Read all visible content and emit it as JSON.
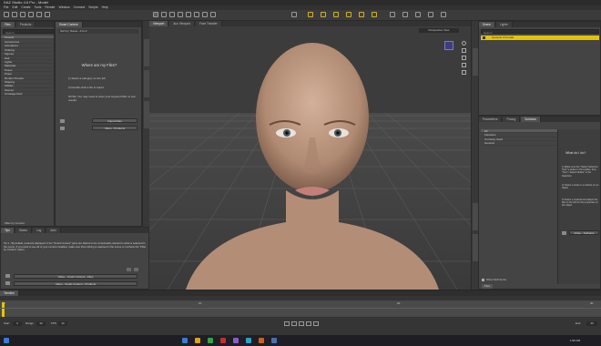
{
  "window": {
    "title": "DAZ Studio 4.6 Pro - Model"
  },
  "menu": [
    "File",
    "Edit",
    "Create",
    "Tools",
    "Render",
    "Window",
    "Connect",
    "Scripts",
    "Help"
  ],
  "left_panel": {
    "tabs": [
      "Files",
      "Products"
    ],
    "search_placeholder": "Search",
    "category_header": "Presets",
    "categories": [
      "Accessories",
      "Animations",
      "Clothing",
      "Figures",
      "Hair",
      "Lights",
      "Materials",
      "Poses",
      "Props",
      "Render Presets",
      "Shaping",
      "Utilities",
      "Scenes",
      "Uncategorized"
    ],
    "filter_label": "Filter by Context"
  },
  "content_panel": {
    "title_tab": "Smart Content",
    "subheader": "Sort by: Name - A to Z",
    "heading": "Where are my Files?",
    "steps": [
      "1) Select a category on the left",
      "2) Double-click a file to load it"
    ],
    "note": "NOTE: You may need to clear your keyword filter to see results.",
    "buttons": [
      "Import Files",
      "Video - Products"
    ]
  },
  "tips_panel": {
    "tabs": [
      "Tips",
      "Status",
      "Log",
      "Auto"
    ],
    "text": "Tip 1 - By default, products displayed in the \"Smart Content\" pane are filtered to be contextually relevant to what is selected in the scene. If you want to see all of your content installed, make sure that nothing is selected in the scene or uncheck the \"Filter by Context\" option.",
    "buttons": [
      "Video - Smart Content - Files",
      "Video - Smart Content - Products"
    ]
  },
  "viewport": {
    "tabs": [
      "Viewport",
      "Aux Viewport",
      "Face Transfer"
    ],
    "camera_label": "Perspective View"
  },
  "scene_panel": {
    "tabs": [
      "Scene",
      "Lights"
    ],
    "search_placeholder": "Search",
    "rows": [
      {
        "label": "Genesis 2 Female",
        "selected": true
      }
    ]
  },
  "parameters_panel": {
    "tabs": [
      "Parameters",
      "Posing",
      "Surfaces"
    ],
    "rows": [
      "All",
      "Favorites",
      "Currently Used",
      "General"
    ],
    "help_title": "What do I do?",
    "help_steps": [
      "1) Make sure the \"Select Selection Tool\" is active in the toolbar, then \"Tool > Select Nodes\" in the Selection",
      "2) Select a node or a surface on an object",
      "3) Select a material and adjust the lists to the left for the properties on the object"
    ],
    "button": "Video - Surfaces",
    "show_sub_items": "Show Sub Items"
  },
  "timeline": {
    "tab": "Timeline",
    "start_label": "Start",
    "start_value": "0",
    "range_label": "Range",
    "range_value": "30",
    "fps_label": "FPS",
    "fps_value": "30",
    "ticks": [
      "0",
      "10",
      "20",
      "30"
    ],
    "end_label": "End",
    "end_value": "30"
  },
  "taskbar": {
    "time": "1:55 PM",
    "icon_colors": [
      "#3a7bd5",
      "#e0a020",
      "#3aa04a",
      "#c03030",
      "#8a5ad0",
      "#30a0c0",
      "#d06020",
      "#4a6fb0"
    ]
  },
  "colors": {
    "highlight": "#e4c400",
    "panel": "#444444",
    "viewport": "#3d3d3d"
  }
}
